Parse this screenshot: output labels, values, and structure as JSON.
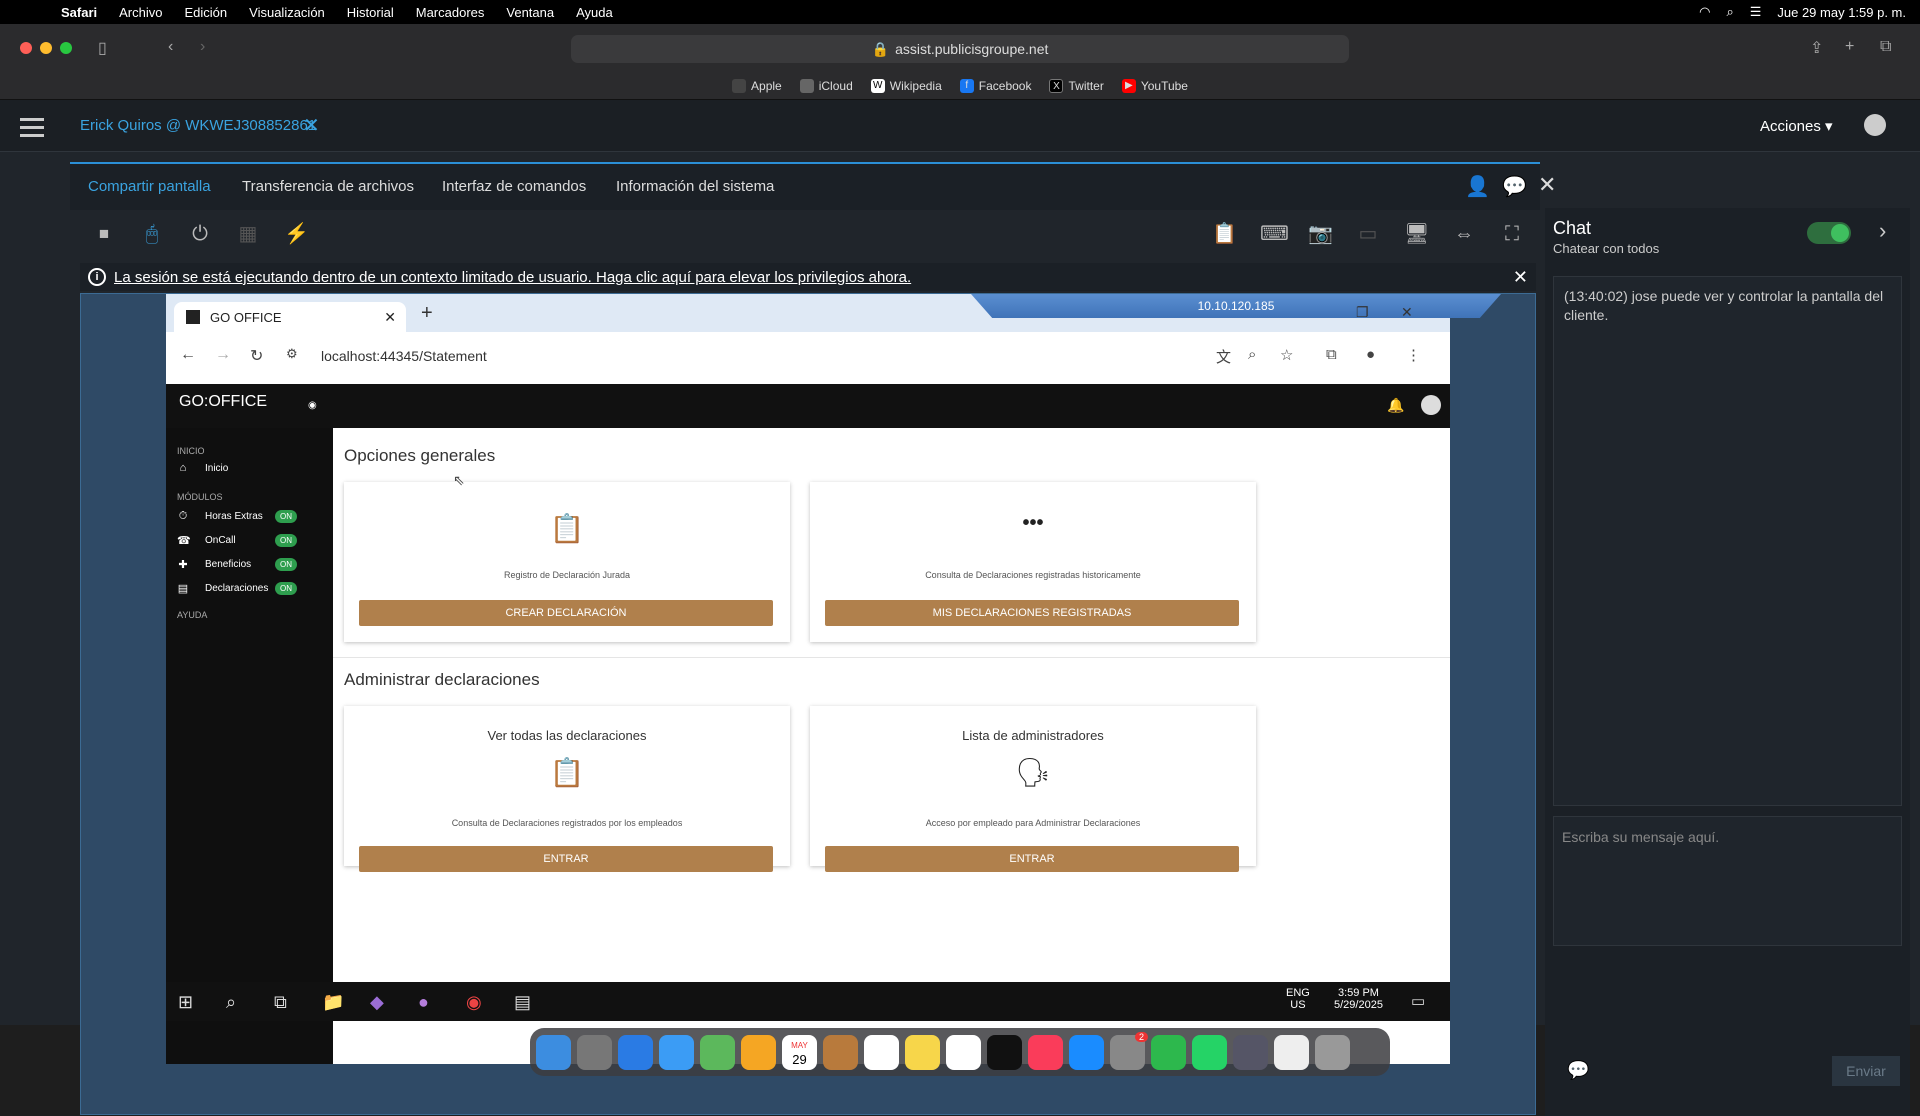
{
  "menubar": {
    "app": "Safari",
    "items": [
      "Archivo",
      "Edición",
      "Visualización",
      "Historial",
      "Marcadores",
      "Ventana",
      "Ayuda"
    ],
    "datetime": "Jue 29 may  1:59 p. m."
  },
  "safari": {
    "url": "assist.publicisgroupe.net",
    "favorites": [
      {
        "label": "Apple",
        "color": "#fff"
      },
      {
        "label": "iCloud",
        "color": "#aaa"
      },
      {
        "label": "Wikipedia",
        "color": "#fff"
      },
      {
        "label": "Facebook",
        "color": "#1877f2"
      },
      {
        "label": "Twitter",
        "color": "#000"
      },
      {
        "label": "YouTube",
        "color": "#ff0000"
      }
    ]
  },
  "session": {
    "name": "Erick Quiros @ WKWEJ308852861",
    "acciones": "Acciones"
  },
  "tabs": [
    "Compartir pantalla",
    "Transferencia de archivos",
    "Interfaz de comandos",
    "Información del sistema"
  ],
  "banner": {
    "text": "La sesión se está ejecutando dentro de un contexto limitado de usuario. Haga clic aquí para elevar los privilegios ahora."
  },
  "remote": {
    "rdp_ip": "10.10.120.185",
    "chrome_tab": "GO OFFICE",
    "chrome_url": "localhost:44345/Statement",
    "app_logo": "GO:OFFICE",
    "sidebar": {
      "sec_inicio": "INICIO",
      "inicio": "Inicio",
      "sec_modulos": "MÓDULOS",
      "modules": [
        {
          "label": "Horas Extras",
          "badge": "ON",
          "icon": "⏱"
        },
        {
          "label": "OnCall",
          "badge": "ON",
          "icon": "☎"
        },
        {
          "label": "Beneficios",
          "badge": "ON",
          "icon": "✚"
        },
        {
          "label": "Declaraciones",
          "badge": "ON",
          "icon": "▤"
        }
      ],
      "sec_ayuda": "AYUDA"
    },
    "sections": [
      {
        "title": "Opciones generales"
      },
      {
        "title": "Administrar declaraciones"
      }
    ],
    "cards": [
      {
        "title": "",
        "icon": "📋",
        "desc": "Registro de Declaración Jurada",
        "button": "CREAR DECLARACIÓN"
      },
      {
        "title": "",
        "icon": "•••",
        "desc": "Consulta de Declaraciones registradas historicamente",
        "button": "MIS DECLARACIONES REGISTRADAS"
      },
      {
        "title": "Ver todas las declaraciones",
        "icon": "📋",
        "desc": "Consulta de Declaraciones registrados por los empleados",
        "button": "ENTRAR"
      },
      {
        "title": "Lista de administradores",
        "icon": "🗣",
        "desc": "Acceso por empleado para Administrar Declaraciones",
        "button": "ENTRAR"
      }
    ],
    "taskbar": {
      "lang1": "ENG",
      "lang2": "US",
      "time": "3:59 PM",
      "date": "5/29/2025"
    }
  },
  "chat": {
    "title": "Chat",
    "subtitle": "Chatear con todos",
    "message": "(13:40:02) jose puede ver y controlar la pantalla del cliente.",
    "placeholder": "Escriba su mensaje aquí.",
    "send": "Enviar"
  },
  "dock": {
    "calendar_day": "29",
    "calendar_month": "MAY",
    "badge": "2"
  }
}
